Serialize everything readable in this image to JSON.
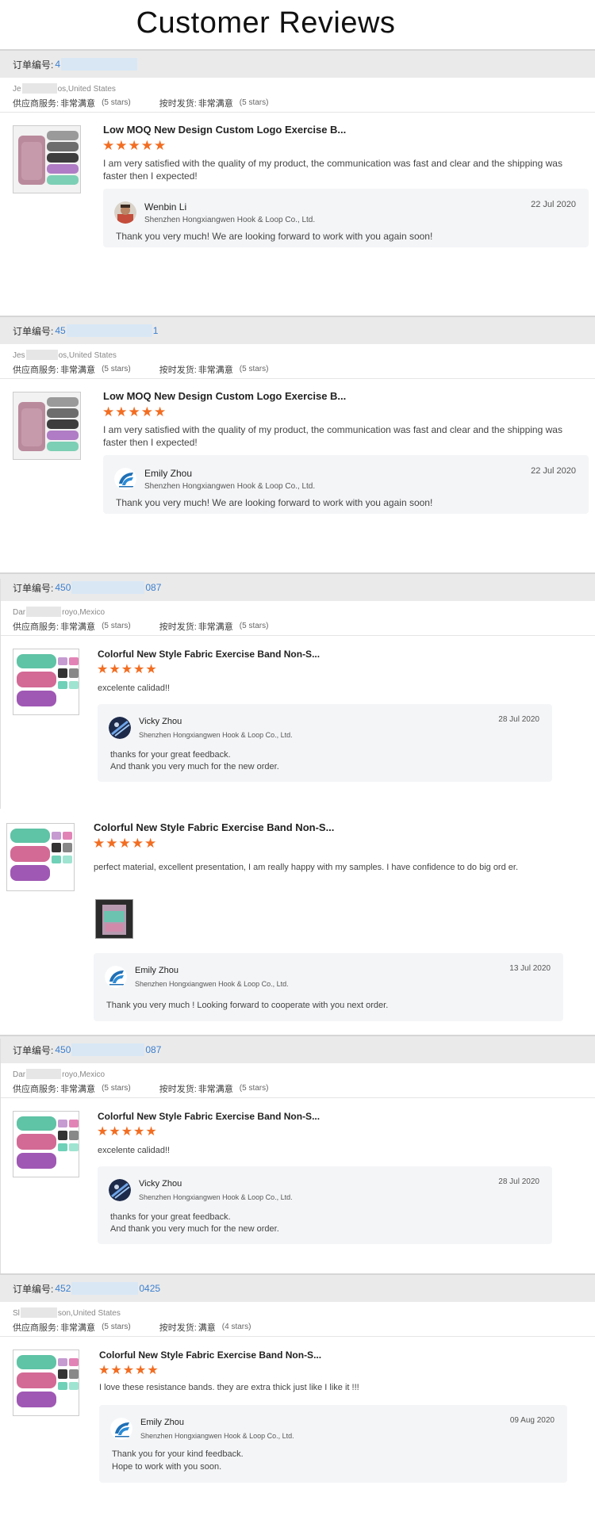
{
  "page_title": "Customer Reviews",
  "labels": {
    "order_no": "订单编号:",
    "supplier_service": "供应商服务:",
    "on_time_delivery": "按时发货:",
    "very_satisfied": "非常满意",
    "satisfied": "满意",
    "five_stars": "(5 stars)",
    "four_stars": "(4 stars)"
  },
  "reviews": [
    {
      "order_prefix": "4",
      "order_suffix": "",
      "buyer_prefix": "Je",
      "buyer_suffix": "os,United States",
      "supplier_rating": "非常满意",
      "supplier_stars": "(5 stars)",
      "delivery_rating": "非常满意",
      "delivery_stars": "(5 stars)",
      "product_title": "Low MOQ New Design Custom Logo Exercise B...",
      "stars": "★★★★★",
      "review_text": "I am very satisfied with the quality of my product, the communication was fast and clear and the shipping was faster then I expected!",
      "reply": {
        "name": "Wenbin Li",
        "company": "Shenzhen Hongxiangwen Hook & Loop Co., Ltd.",
        "date": "22 Jul 2020",
        "text": "Thank you very much!  We are looking forward to work with you again soon!"
      }
    },
    {
      "order_prefix": "45",
      "order_suffix": "1",
      "buyer_prefix": "Jes",
      "buyer_suffix": "os,United States",
      "supplier_rating": "非常满意",
      "supplier_stars": "(5 stars)",
      "delivery_rating": "非常满意",
      "delivery_stars": "(5 stars)",
      "product_title": "Low MOQ New Design Custom Logo Exercise B...",
      "stars": "★★★★★",
      "review_text": "I am very satisfied with the quality of my product, the communication was fast and clear and the shipping was faster then I expected!",
      "reply": {
        "name": "Emily Zhou",
        "company": "Shenzhen Hongxiangwen Hook & Loop Co., Ltd.",
        "date": "22 Jul 2020",
        "text": "Thank you very much!  We are looking forward to work with you again soon!"
      }
    },
    {
      "order_prefix": "450",
      "order_suffix": "087",
      "buyer_prefix": "Dar",
      "buyer_suffix": "royo,Mexico",
      "supplier_rating": "非常满意",
      "supplier_stars": "(5 stars)",
      "delivery_rating": "非常满意",
      "delivery_stars": "(5 stars)",
      "product_title": "Colorful New Style Fabric Exercise Band Non-S...",
      "stars": "★★★★★",
      "review_text": "excelente calidad!!",
      "reply": {
        "name": "Vicky Zhou",
        "company": "Shenzhen Hongxiangwen Hook & Loop Co., Ltd.",
        "date": "28 Jul 2020",
        "text_line1": "thanks for your great feedback.",
        "text_line2": "And thank you very much for the new order."
      }
    },
    {
      "product_title": "Colorful New Style Fabric Exercise Band Non-S...",
      "stars": "★★★★★",
      "review_text": "perfect material, excellent presentation, I am really happy with my samples. I have confidence to do big ord er.",
      "reply": {
        "name": "Emily Zhou",
        "company": "Shenzhen Hongxiangwen Hook & Loop Co., Ltd.",
        "date": "13 Jul 2020",
        "text": "Thank you very much ! Looking forward to cooperate with you next order."
      }
    },
    {
      "order_prefix": "450",
      "order_suffix": "087",
      "buyer_prefix": "Dar",
      "buyer_suffix": "royo,Mexico",
      "supplier_rating": "非常满意",
      "supplier_stars": "(5 stars)",
      "delivery_rating": "非常满意",
      "delivery_stars": "(5 stars)",
      "product_title": "Colorful New Style Fabric Exercise Band Non-S...",
      "stars": "★★★★★",
      "review_text": "excelente calidad!!",
      "reply": {
        "name": "Vicky Zhou",
        "company": "Shenzhen Hongxiangwen Hook & Loop Co., Ltd.",
        "date": "28 Jul 2020",
        "text_line1": "thanks for your great feedback.",
        "text_line2": "And thank you very much for the new order."
      }
    },
    {
      "order_prefix": "452",
      "order_suffix": "0425",
      "buyer_prefix": "Sl",
      "buyer_suffix": "son,United States",
      "supplier_rating": "非常满意",
      "supplier_stars": "(5 stars)",
      "delivery_rating": "满意",
      "delivery_stars": "(4 stars)",
      "product_title": "Colorful New Style Fabric Exercise Band Non-S...",
      "stars": "★★★★★",
      "review_text": "I love these resistance bands. they are extra thick just like I like it !!!",
      "reply": {
        "name": "Emily Zhou",
        "company": "Shenzhen Hongxiangwen Hook & Loop Co., Ltd.",
        "date": "09 Aug 2020",
        "text_line1": "Thank you for your kind feedback.",
        "text_line2": "Hope to work with you soon."
      }
    }
  ],
  "colors": {
    "star": "#f26d21",
    "order_link": "#3a7fd0",
    "header_bar": "#eaeaea",
    "reply_bg": "#f4f5f7"
  }
}
